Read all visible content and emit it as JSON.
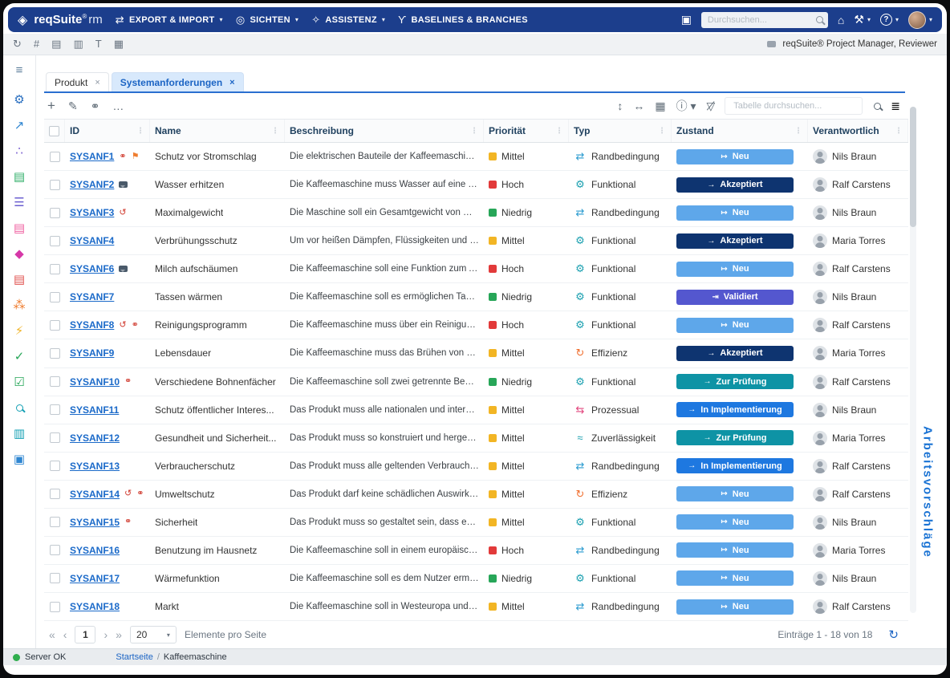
{
  "topbar": {
    "brand": "reqSuite",
    "brand_reg": "®",
    "brand_suffix": "rm",
    "menus": [
      {
        "name": "menu-export-import",
        "icon": "swap-arrows-icon",
        "glyph": "⇄",
        "label": "EXPORT & IMPORT",
        "caret": "▾"
      },
      {
        "name": "menu-sichten",
        "icon": "views-icon",
        "glyph": "◎",
        "label": "SICHTEN",
        "caret": "▾"
      },
      {
        "name": "menu-assistenz",
        "icon": "assistant-icon",
        "glyph": "✧",
        "label": "ASSISTENZ",
        "caret": "▾"
      },
      {
        "name": "menu-baselines-branches",
        "icon": "branch-icon",
        "glyph": "ϒ",
        "label": "BASELINES & BRANCHES",
        "caret": ""
      }
    ],
    "device_glyph": "▣",
    "search_placeholder": "Durchsuchen...",
    "home_glyph": "⌂",
    "tools_glyph": "⚒",
    "tools_caret": "▾",
    "help_glyph": "?",
    "help_caret": "▾",
    "avatar_caret": "▾"
  },
  "toolbar2": {
    "icons": [
      {
        "name": "refresh-icon",
        "glyph": "↻"
      },
      {
        "name": "hierarchy-icon",
        "glyph": "#"
      },
      {
        "name": "report-icon",
        "glyph": "▤"
      },
      {
        "name": "document-icon",
        "glyph": "▥"
      },
      {
        "name": "text-tool-icon",
        "glyph": "T"
      },
      {
        "name": "archive-icon",
        "glyph": "▦"
      }
    ],
    "roles": "reqSuite® Project Manager, Reviewer"
  },
  "sidebar": {
    "items": [
      {
        "name": "sidebar-menu-icon",
        "glyph": "≡",
        "color": "#5b7c99"
      },
      {
        "name": "sidebar-settings-icon",
        "glyph": "⚙",
        "color": "#2a6fc0"
      },
      {
        "name": "sidebar-export-icon",
        "glyph": "↗",
        "color": "#2f86d1"
      },
      {
        "name": "sidebar-model-icon",
        "glyph": "∴",
        "color": "#7a5fd0"
      },
      {
        "name": "sidebar-document-green-icon",
        "glyph": "▤",
        "color": "#2fae68"
      },
      {
        "name": "sidebar-list-icon",
        "glyph": "☰",
        "color": "#6b5fd0"
      },
      {
        "name": "sidebar-document-pink-icon",
        "glyph": "▤",
        "color": "#ef5fa0"
      },
      {
        "name": "sidebar-shapes-icon",
        "glyph": "◆",
        "color": "#d638a8"
      },
      {
        "name": "sidebar-document-red-icon",
        "glyph": "▤",
        "color": "#e0524f"
      },
      {
        "name": "sidebar-team-icon",
        "glyph": "⁂",
        "color": "#ef7d2f"
      },
      {
        "name": "sidebar-actions-icon",
        "glyph": "⚡",
        "color": "#f0b429"
      },
      {
        "name": "sidebar-check-icon",
        "glyph": "✓",
        "color": "#27a658"
      },
      {
        "name": "sidebar-checklist-icon",
        "glyph": "☑",
        "color": "#27a658"
      },
      {
        "name": "sidebar-search-icon",
        "type": "mag",
        "glyph": "",
        "color": "#14a0b4"
      },
      {
        "name": "sidebar-validation-icon",
        "glyph": "▥",
        "color": "#14a0b4"
      },
      {
        "name": "sidebar-book-icon",
        "glyph": "▣",
        "color": "#2f86d1"
      }
    ]
  },
  "tabs": {
    "close_glyph": "×",
    "items": [
      {
        "label": "Produkt",
        "active": false
      },
      {
        "label": "Systemanforderungen",
        "active": true
      }
    ]
  },
  "table_toolbar": {
    "left": [
      {
        "name": "add-icon",
        "glyph": "+"
      },
      {
        "name": "edit-icon",
        "glyph": "✎"
      },
      {
        "name": "link-icon",
        "glyph": "⚭"
      },
      {
        "name": "more-options-icon",
        "glyph": "…"
      }
    ],
    "right": [
      {
        "name": "row-height-icon",
        "glyph": "↕"
      },
      {
        "name": "column-fit-icon",
        "glyph": "↔"
      },
      {
        "name": "grid-columns-icon",
        "glyph": "▦"
      },
      {
        "name": "info-menu-icon",
        "glyph": "ⓘ ▾"
      },
      {
        "name": "filter-remove-icon",
        "glyph": "▽̸"
      }
    ],
    "search_placeholder": "Tabelle durchsuchen...",
    "settings_glyph": "≣"
  },
  "table": {
    "columns": [
      "ID",
      "Name",
      "Beschreibung",
      "Priorität",
      "Typ",
      "Zustand",
      "Verantwortlich"
    ],
    "priorities": {
      "Mittel": "#f2b524",
      "Hoch": "#e23a3a",
      "Niedrig": "#27a658"
    },
    "types": {
      "Randbedingung": {
        "glyph": "⇄",
        "color": "#2b9bd0"
      },
      "Funktional": {
        "glyph": "⚙",
        "color": "#1ba0b0"
      },
      "Effizienz": {
        "glyph": "↻",
        "color": "#f07030"
      },
      "Prozessual": {
        "glyph": "⇆",
        "color": "#e2447c"
      },
      "Zuverlässigkeit": {
        "glyph": "≈",
        "color": "#1ba0b0"
      }
    },
    "states": {
      "Neu": {
        "color": "#5ea7ea",
        "icon": "↦"
      },
      "Akzeptiert": {
        "color": "#0e3470",
        "icon": "→"
      },
      "Validiert": {
        "color": "#5457cf",
        "icon": "⇥"
      },
      "Zur Prüfung": {
        "color": "#0e93a5",
        "icon": "→"
      },
      "In Implementierung": {
        "color": "#1e78e0",
        "icon": "→"
      }
    },
    "badge_icons": {
      "link": {
        "glyph": "⚭",
        "color": "#d03a2e"
      },
      "history": {
        "glyph": "↺",
        "color": "#d03a2e"
      },
      "flag": {
        "glyph": "⚑",
        "color": "#ef7d2f"
      },
      "comment": {
        "glyph": "",
        "color": "#4a5a6a"
      }
    },
    "rows": [
      {
        "id": "SYSANF1",
        "badges": [
          "link",
          "flag"
        ],
        "name": "Schutz vor Stromschlag",
        "beschreibung": "Die elektrischen Bauteile der Kaffeemaschine soll...",
        "prioritaet": "Mittel",
        "typ": "Randbedingung",
        "zustand": "Neu",
        "verantwortlich": "Nils Braun"
      },
      {
        "id": "SYSANF2",
        "badges": [
          "comment"
        ],
        "name": "Wasser erhitzen",
        "beschreibung": "Die Kaffeemaschine muss Wasser auf eine Temp...",
        "prioritaet": "Hoch",
        "typ": "Funktional",
        "zustand": "Akzeptiert",
        "verantwortlich": "Ralf Carstens"
      },
      {
        "id": "SYSANF3",
        "badges": [
          "history"
        ],
        "name": "Maximalgewicht",
        "beschreibung": "Die Maschine soll ein Gesamtgewicht von maxim...",
        "prioritaet": "Niedrig",
        "typ": "Randbedingung",
        "zustand": "Neu",
        "verantwortlich": "Nils Braun"
      },
      {
        "id": "SYSANF4",
        "badges": [],
        "name": "Verbrühungsschutz",
        "beschreibung": "Um vor heißen Dämpfen, Flüssigkeiten und Baute...",
        "prioritaet": "Mittel",
        "typ": "Funktional",
        "zustand": "Akzeptiert",
        "verantwortlich": "Maria Torres"
      },
      {
        "id": "SYSANF6",
        "badges": [
          "comment"
        ],
        "name": "Milch aufschäumen",
        "beschreibung": "Die Kaffeemaschine soll eine Funktion zum Aufsc...",
        "prioritaet": "Hoch",
        "typ": "Funktional",
        "zustand": "Neu",
        "verantwortlich": "Ralf Carstens"
      },
      {
        "id": "SYSANF7",
        "badges": [],
        "name": "Tassen wärmen",
        "beschreibung": "Die Kaffeemaschine soll es ermöglichen Tassen a...",
        "prioritaet": "Niedrig",
        "typ": "Funktional",
        "zustand": "Validiert",
        "verantwortlich": "Nils Braun"
      },
      {
        "id": "SYSANF8",
        "badges": [
          "history",
          "link"
        ],
        "name": "Reinigungsprogramm",
        "beschreibung": "Die Kaffeemaschine muss über ein Reinigungspr...",
        "prioritaet": "Hoch",
        "typ": "Funktional",
        "zustand": "Neu",
        "verantwortlich": "Ralf Carstens"
      },
      {
        "id": "SYSANF9",
        "badges": [],
        "name": "Lebensdauer",
        "beschreibung": "Die Kaffeemaschine muss das Brühen von einige...",
        "prioritaet": "Mittel",
        "typ": "Effizienz",
        "zustand": "Akzeptiert",
        "verantwortlich": "Maria Torres"
      },
      {
        "id": "SYSANF10",
        "badges": [
          "link"
        ],
        "name": "Verschiedene Bohnenfächer",
        "beschreibung": "Die Kaffeemaschine soll zwei getrennte Behälter f...",
        "prioritaet": "Niedrig",
        "typ": "Funktional",
        "zustand": "Zur Prüfung",
        "verantwortlich": "Ralf Carstens"
      },
      {
        "id": "SYSANF11",
        "badges": [],
        "name": "Schutz öffentlicher Interes...",
        "beschreibung": "Das Produkt muss alle nationalen und internation...",
        "prioritaet": "Mittel",
        "typ": "Prozessual",
        "zustand": "In Implementierung",
        "verantwortlich": "Nils Braun"
      },
      {
        "id": "SYSANF12",
        "badges": [],
        "name": "Gesundheit und Sicherheit...",
        "beschreibung": "Das Produkt muss so konstruiert und hergestellt ...",
        "prioritaet": "Mittel",
        "typ": "Zuverlässigkeit",
        "zustand": "Zur Prüfung",
        "verantwortlich": "Maria Torres"
      },
      {
        "id": "SYSANF13",
        "badges": [],
        "name": "Verbraucherschutz",
        "beschreibung": "Das Produkt muss alle geltenden Verbrauchersch...",
        "prioritaet": "Mittel",
        "typ": "Randbedingung",
        "zustand": "In Implementierung",
        "verantwortlich": "Ralf Carstens"
      },
      {
        "id": "SYSANF14",
        "badges": [
          "history",
          "link"
        ],
        "name": "Umweltschutz",
        "beschreibung": "Das Produkt darf keine schädlichen Auswirkunge...",
        "prioritaet": "Mittel",
        "typ": "Effizienz",
        "zustand": "Neu",
        "verantwortlich": "Ralf Carstens"
      },
      {
        "id": "SYSANF15",
        "badges": [
          "link"
        ],
        "name": "Sicherheit",
        "beschreibung": "Das Produkt muss so gestaltet sein, dass es währ...",
        "prioritaet": "Mittel",
        "typ": "Funktional",
        "zustand": "Neu",
        "verantwortlich": "Nils Braun"
      },
      {
        "id": "SYSANF16",
        "badges": [],
        "name": "Benutzung im Hausnetz",
        "beschreibung": "Die Kaffeemaschine soll in einem europäischen H...",
        "prioritaet": "Hoch",
        "typ": "Randbedingung",
        "zustand": "Neu",
        "verantwortlich": "Maria Torres"
      },
      {
        "id": "SYSANF17",
        "badges": [],
        "name": "Wärmefunktion",
        "beschreibung": "Die Kaffeemaschine soll es dem Nutzer ermöglich...",
        "prioritaet": "Niedrig",
        "typ": "Funktional",
        "zustand": "Neu",
        "verantwortlich": "Nils Braun"
      },
      {
        "id": "SYSANF18",
        "badges": [],
        "name": "Markt",
        "beschreibung": "Die Kaffeemaschine soll in Westeuropa und Süda...",
        "prioritaet": "Mittel",
        "typ": "Randbedingung",
        "zustand": "Neu",
        "verantwortlich": "Ralf Carstens"
      }
    ]
  },
  "pagination": {
    "first_glyph": "«",
    "prev_glyph": "‹",
    "page": "1",
    "next_glyph": "›",
    "last_glyph": "»",
    "page_size": "20",
    "size_caret": "▾",
    "per_page_label": "Elemente pro Seite",
    "entries_label": "Einträge 1 - 18 von 18",
    "refresh_glyph": "↻"
  },
  "right_panel": {
    "label": "Arbeitsvorschläge"
  },
  "statusbar": {
    "server_status": "Server OK",
    "breadcrumb_home": "Startseite",
    "breadcrumb_sep": "/",
    "breadcrumb_current": "Kaffeemaschine"
  }
}
